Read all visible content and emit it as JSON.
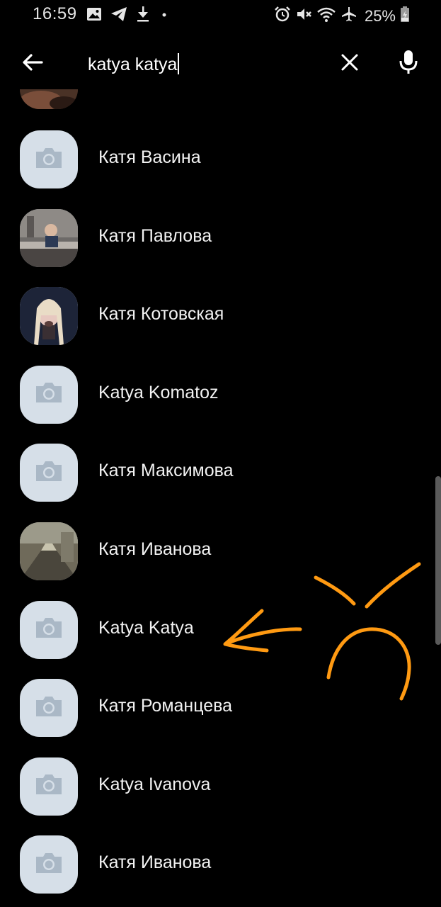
{
  "status_bar": {
    "time": "16:59",
    "battery_percent": "25%",
    "left_icons": [
      "image-icon",
      "telegram-icon",
      "download-icon",
      "dot-icon"
    ],
    "right_icons": [
      "alarm-icon",
      "mute-icon",
      "wifi-icon",
      "airplane-icon",
      "battery-icon"
    ]
  },
  "search": {
    "query": "katya katya",
    "back_icon": "arrow-left-icon",
    "clear_icon": "close-icon",
    "voice_icon": "microphone-icon"
  },
  "results": [
    {
      "name": "Катя Васина",
      "avatar": "placeholder"
    },
    {
      "name": "Катя Павлова",
      "avatar": "photo"
    },
    {
      "name": "Катя Котовская",
      "avatar": "photo"
    },
    {
      "name": "Katya Komatoz",
      "avatar": "placeholder"
    },
    {
      "name": "Катя Максимова",
      "avatar": "placeholder"
    },
    {
      "name": "Катя Иванова",
      "avatar": "photo"
    },
    {
      "name": "Katya Katya",
      "avatar": "placeholder"
    },
    {
      "name": "Катя Романцева",
      "avatar": "placeholder"
    },
    {
      "name": "Katya Ivanova",
      "avatar": "placeholder"
    },
    {
      "name": "Катя Иванова",
      "avatar": "placeholder"
    }
  ],
  "colors": {
    "background": "#000000",
    "text": "#f2f2f2",
    "avatar_placeholder": "#d6dfe8",
    "camera_icon": "#aab8c6",
    "annotation": "#ff9a12"
  }
}
